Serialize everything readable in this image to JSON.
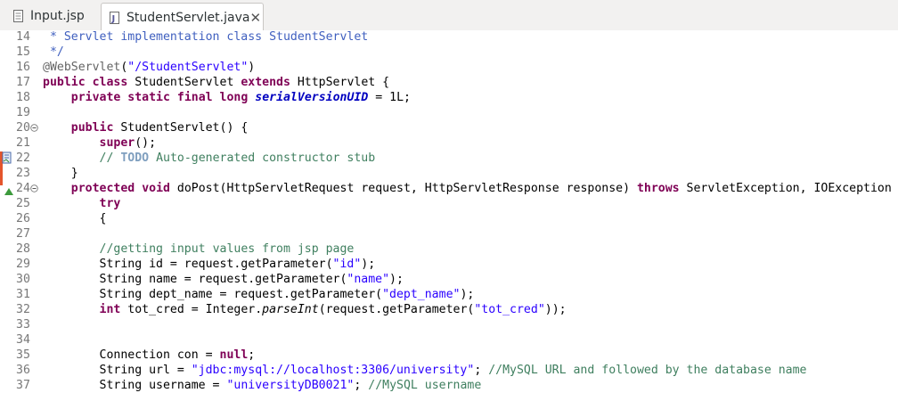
{
  "tabs": [
    {
      "label": "Input.jsp",
      "active": false,
      "icon": "jsp-file-icon"
    },
    {
      "label": "StudentServlet.java",
      "active": true,
      "icon": "java-file-icon",
      "close": "✕"
    }
  ],
  "lines": [
    {
      "n": "14",
      "code": " * Servlet implementation class StudentServlet"
    },
    {
      "n": "15",
      "code": " */"
    },
    {
      "n": "16",
      "code": "@WebServlet(\"/StudentServlet\")"
    },
    {
      "n": "17",
      "code": "public class StudentServlet extends HttpServlet {"
    },
    {
      "n": "18",
      "code": "    private static final long serialVersionUID = 1L;"
    },
    {
      "n": "19",
      "code": ""
    },
    {
      "n": "20",
      "code": "    public StudentServlet() {"
    },
    {
      "n": "21",
      "code": "        super();"
    },
    {
      "n": "22",
      "code": "        // TODO Auto-generated constructor stub"
    },
    {
      "n": "23",
      "code": "    }"
    },
    {
      "n": "24",
      "code": "    protected void doPost(HttpServletRequest request, HttpServletResponse response) throws ServletException, IOException"
    },
    {
      "n": "25",
      "code": "        try"
    },
    {
      "n": "26",
      "code": "        {"
    },
    {
      "n": "27",
      "code": ""
    },
    {
      "n": "28",
      "code": "        //getting input values from jsp page"
    },
    {
      "n": "29",
      "code": "        String id = request.getParameter(\"id\");"
    },
    {
      "n": "30",
      "code": "        String name = request.getParameter(\"name\");"
    },
    {
      "n": "31",
      "code": "        String dept_name = request.getParameter(\"dept_name\");"
    },
    {
      "n": "32",
      "code": "        int tot_cred = Integer.parseInt(request.getParameter(\"tot_cred\"));"
    },
    {
      "n": "33",
      "code": ""
    },
    {
      "n": "34",
      "code": ""
    },
    {
      "n": "35",
      "code": "        Connection con = null;"
    },
    {
      "n": "36",
      "code": "        String url = \"jdbc:mysql://localhost:3306/university\"; //MySQL URL and followed by the database name"
    },
    {
      "n": "37",
      "code": "        String username = \"universityDB0021\"; //MySQL username"
    }
  ],
  "colors": {
    "keyword": "#7f0055",
    "string": "#2a00ff",
    "comment": "#3f7f5f",
    "javadoc": "#3f5fbf",
    "field": "#0000c0"
  },
  "gutter_icons": {
    "fold": "fold-minus-icon",
    "task": "task-marker-icon",
    "override": "override-triangle-icon"
  }
}
